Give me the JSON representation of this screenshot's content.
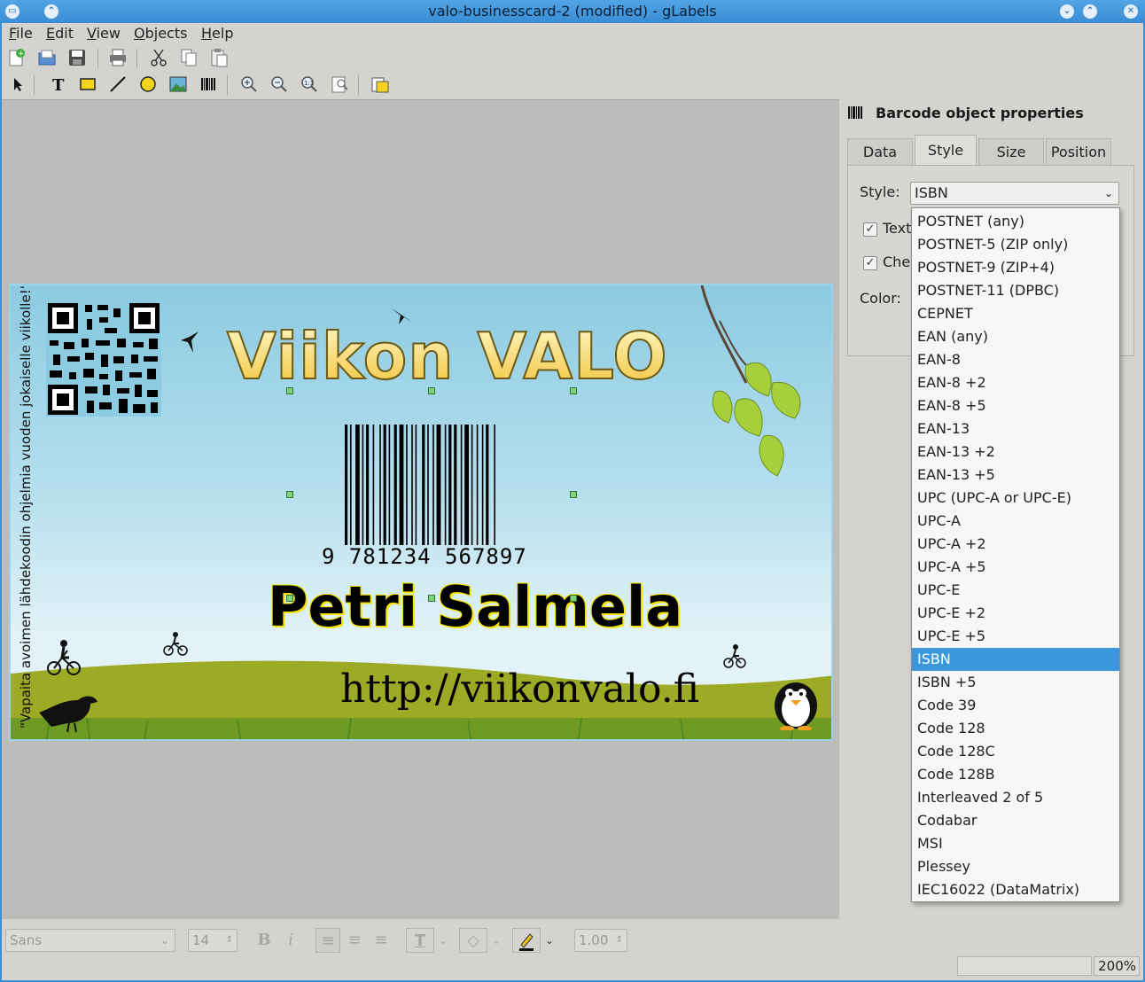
{
  "window": {
    "title": "valo-businesscard-2 (modified) - gLabels"
  },
  "menubar": {
    "items": [
      {
        "label": "File",
        "mnemonic": "F",
        "rest": "ile"
      },
      {
        "label": "Edit",
        "mnemonic": "E",
        "rest": "dit"
      },
      {
        "label": "View",
        "mnemonic": "V",
        "rest": "iew"
      },
      {
        "label": "Objects",
        "mnemonic": "O",
        "rest": "bjects"
      },
      {
        "label": "Help",
        "mnemonic": "H",
        "rest": "elp"
      }
    ]
  },
  "toolbar_main": {
    "icons": [
      "new-icon",
      "open-icon",
      "save-icon",
      "print-icon",
      "cut-icon",
      "copy-icon",
      "paste-icon"
    ]
  },
  "toolbar_drawing": {
    "icons": [
      "pointer-icon",
      "text-icon",
      "box-icon",
      "line-icon",
      "ellipse-icon",
      "image-icon",
      "barcode-icon",
      "zoom-in-icon",
      "zoom-out-icon",
      "zoom-1to1-icon",
      "zoom-fit-icon",
      "merge-properties-icon"
    ]
  },
  "card": {
    "vertical_text": "\"Vapaita avoimen lähdekoodin ohjelmia vuoden jokaiselle viikolle!\"",
    "title": "Viikon VALO",
    "barcode_digits": "9 781234 567897",
    "name": "Petri Salmela",
    "url": "http://viikonvalo.fi"
  },
  "properties": {
    "title": "Barcode object properties",
    "tabs": [
      "Data",
      "Style",
      "Size",
      "Position"
    ],
    "active_tab": "Style",
    "style_label": "Style:",
    "style_value": "ISBN",
    "text_checkbox_label": "Text",
    "checksum_checkbox_label": "Che",
    "color_label": "Color:"
  },
  "dropdown": {
    "options": [
      "POSTNET (any)",
      "POSTNET-5 (ZIP only)",
      "POSTNET-9 (ZIP+4)",
      "POSTNET-11 (DPBC)",
      "CEPNET",
      "EAN (any)",
      "EAN-8",
      "EAN-8 +2",
      "EAN-8 +5",
      "EAN-13",
      "EAN-13 +2",
      "EAN-13 +5",
      "UPC (UPC-A or UPC-E)",
      "UPC-A",
      "UPC-A +2",
      "UPC-A +5",
      "UPC-E",
      "UPC-E +2",
      "UPC-E +5",
      "ISBN",
      "ISBN +5",
      "Code 39",
      "Code 128",
      "Code 128C",
      "Code 128B",
      "Interleaved 2 of 5",
      "Codabar",
      "MSI",
      "Plessey",
      "IEC16022 (DataMatrix)"
    ],
    "selected": "ISBN"
  },
  "format_bar": {
    "font_family": "Sans",
    "font_size": "14",
    "line_width": "1.00"
  },
  "statusbar": {
    "zoom": "200%"
  }
}
